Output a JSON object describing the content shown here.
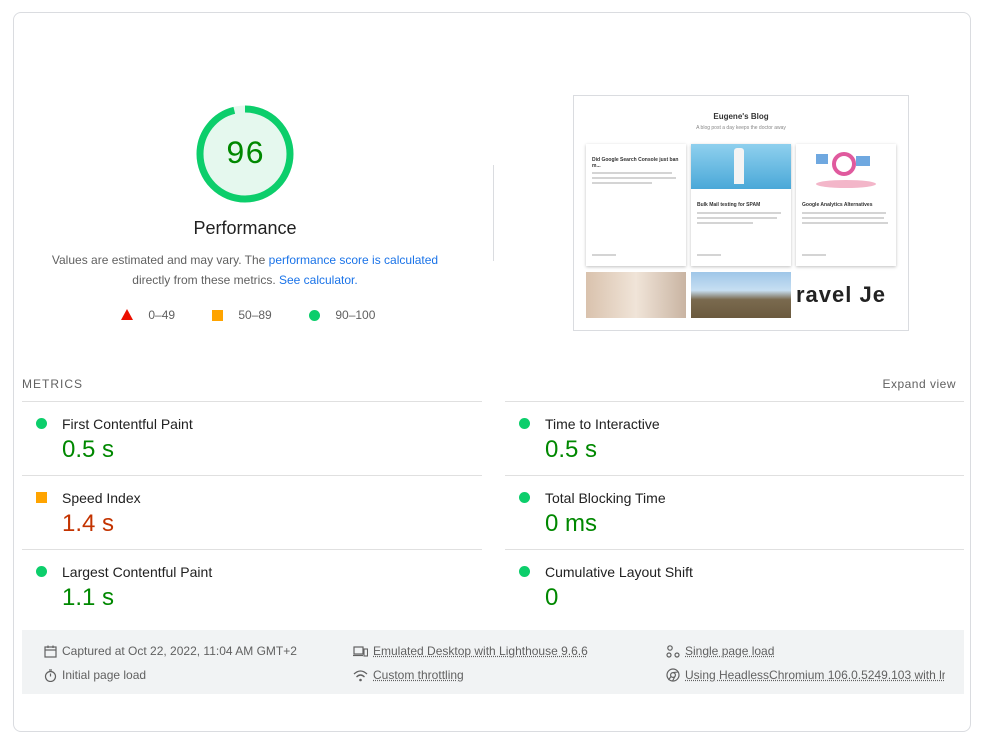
{
  "summary": {
    "score": "96",
    "category": "Performance",
    "desc_pre": "Values are estimated and may vary. The ",
    "desc_link": "performance score is calculated",
    "desc_mid": " directly from these metrics. ",
    "desc_calc": "See calculator.",
    "score_fraction": 0.96,
    "legend": [
      {
        "range": "0–49",
        "color": "#eb0f00"
      },
      {
        "range": "50–89",
        "color": "#ffa400"
      },
      {
        "range": "90–100",
        "color": "#0cce6b"
      }
    ]
  },
  "screenshot": {
    "blog_title": "Eugene's Blog",
    "blog_subtitle": "A blog post a day keeps the doctor away",
    "post1_title": "Did Google Search Console just ban m...",
    "post2_title": "Bulk Mail testing for SPAM",
    "post3_title": "Google Analytics Alternatives",
    "overflow_text": "ravel Je"
  },
  "metrics": {
    "title": "METRICS",
    "expand": "Expand view",
    "items": [
      {
        "name": "First Contentful Paint",
        "value": "0.5 s",
        "status": "green"
      },
      {
        "name": "Time to Interactive",
        "value": "0.5 s",
        "status": "green"
      },
      {
        "name": "Speed Index",
        "value": "1.4 s",
        "status": "orange"
      },
      {
        "name": "Total Blocking Time",
        "value": "0 ms",
        "status": "green"
      },
      {
        "name": "Largest Contentful Paint",
        "value": "1.1 s",
        "status": "green"
      },
      {
        "name": "Cumulative Layout Shift",
        "value": "0",
        "status": "green"
      }
    ]
  },
  "footer": {
    "captured": "Captured at Oct 22, 2022, 11:04 AM GMT+2",
    "initial": "Initial page load",
    "emulated": "Emulated Desktop with Lighthouse 9.6.6",
    "throttling": "Custom throttling",
    "single": "Single page load",
    "browser": "Using HeadlessChromium 106.0.5249.103 with lr"
  },
  "colors": {
    "pass": "#0cce6b",
    "average": "#ffa400",
    "fail": "#eb0f00",
    "link": "#1a73e8"
  }
}
